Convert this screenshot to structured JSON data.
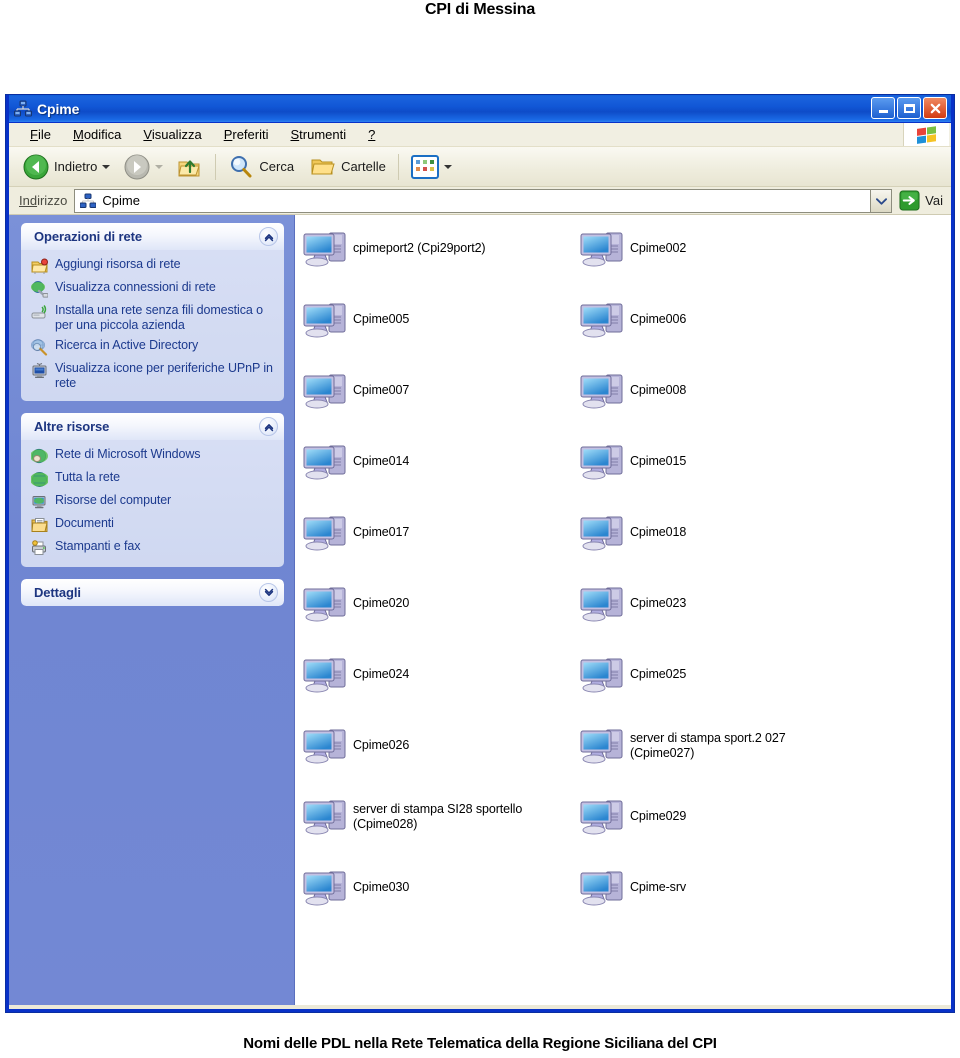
{
  "document": {
    "heading": "CPI di Messina",
    "caption": "Nomi delle PDL nella Rete Telematica della Regione Siciliana del CPI"
  },
  "window": {
    "title": "Cpime",
    "title_icon": "network-workgroup-icon",
    "buttons": {
      "minimize": "minimize-icon",
      "maximize": "maximize-icon",
      "close": "close-icon"
    }
  },
  "menubar": {
    "items": [
      {
        "label": "File",
        "accel": "F"
      },
      {
        "label": "Modifica",
        "accel": "M"
      },
      {
        "label": "Visualizza",
        "accel": "V"
      },
      {
        "label": "Preferiti",
        "accel": "P"
      },
      {
        "label": "Strumenti",
        "accel": "S"
      },
      {
        "label": "?",
        "accel": "?"
      }
    ],
    "brand_icon": "windows-flag-icon"
  },
  "toolbar": {
    "back_label": "Indietro",
    "back_icon": "back-arrow-icon",
    "forward_icon": "forward-arrow-icon",
    "up_icon": "up-folder-icon",
    "search_label": "Cerca",
    "search_icon": "magnifier-icon",
    "folders_label": "Cartelle",
    "folders_icon": "folder-icon",
    "views_icon": "views-grid-icon"
  },
  "addressbar": {
    "label": "Indirizzo",
    "value": "Cpime",
    "icon": "network-workgroup-icon",
    "dropdown_icon": "chevron-down-icon",
    "go_label": "Vai",
    "go_icon": "go-arrow-icon"
  },
  "sidebar": {
    "panels": [
      {
        "title": "Operazioni di rete",
        "collapse_icon": "chevron-up-icon",
        "collapsed": false,
        "items": [
          {
            "label": "Aggiungi risorsa di rete",
            "icon": "add-network-place-icon"
          },
          {
            "label": "Visualizza connessioni di rete",
            "icon": "network-connections-icon"
          },
          {
            "label": "Installa una rete senza fili domestica o per una piccola azienda",
            "icon": "wireless-network-icon"
          },
          {
            "label": "Ricerca in Active Directory",
            "icon": "active-directory-search-icon"
          },
          {
            "label": "Visualizza icone per periferiche UPnP in rete",
            "icon": "upnp-device-icon"
          }
        ]
      },
      {
        "title": "Altre risorse",
        "collapse_icon": "chevron-up-icon",
        "collapsed": false,
        "items": [
          {
            "label": "Rete di Microsoft Windows",
            "icon": "microsoft-network-icon"
          },
          {
            "label": "Tutta la rete",
            "icon": "entire-network-icon"
          },
          {
            "label": "Risorse del computer",
            "icon": "my-computer-icon"
          },
          {
            "label": "Documenti",
            "icon": "my-documents-icon"
          },
          {
            "label": "Stampanti e fax",
            "icon": "printers-and-faxes-icon"
          }
        ]
      },
      {
        "title": "Dettagli",
        "collapse_icon": "chevron-down-icon",
        "collapsed": true,
        "items": []
      }
    ]
  },
  "content": {
    "icon_type": "computer-icon",
    "items": [
      {
        "label": "cpimeport2 (Cpi29port2)"
      },
      {
        "label": "Cpime002"
      },
      {
        "label": "Cpime005"
      },
      {
        "label": "Cpime006"
      },
      {
        "label": "Cpime007"
      },
      {
        "label": "Cpime008"
      },
      {
        "label": "Cpime014"
      },
      {
        "label": "Cpime015"
      },
      {
        "label": "Cpime017"
      },
      {
        "label": "Cpime018"
      },
      {
        "label": "Cpime020"
      },
      {
        "label": "Cpime023"
      },
      {
        "label": "Cpime024"
      },
      {
        "label": "Cpime025"
      },
      {
        "label": "Cpime026"
      },
      {
        "label": "server di stampa sport.2 027\n(Cpime027)"
      },
      {
        "label": "server di stampa SI28 sportello\n(Cpime028)"
      },
      {
        "label": "Cpime029"
      },
      {
        "label": "Cpime030"
      },
      {
        "label": "Cpime-srv"
      }
    ]
  },
  "colors": {
    "titlebar_blue": "#1157d6",
    "window_border": "#0831c8",
    "sidebar_blue": "#7388d4",
    "panel_body": "#d3dbf2",
    "panel_title": "#1d3580",
    "link_blue": "#1c3a8e",
    "toolbar_beige": "#efedde",
    "go_green": "#2e9b2e"
  }
}
